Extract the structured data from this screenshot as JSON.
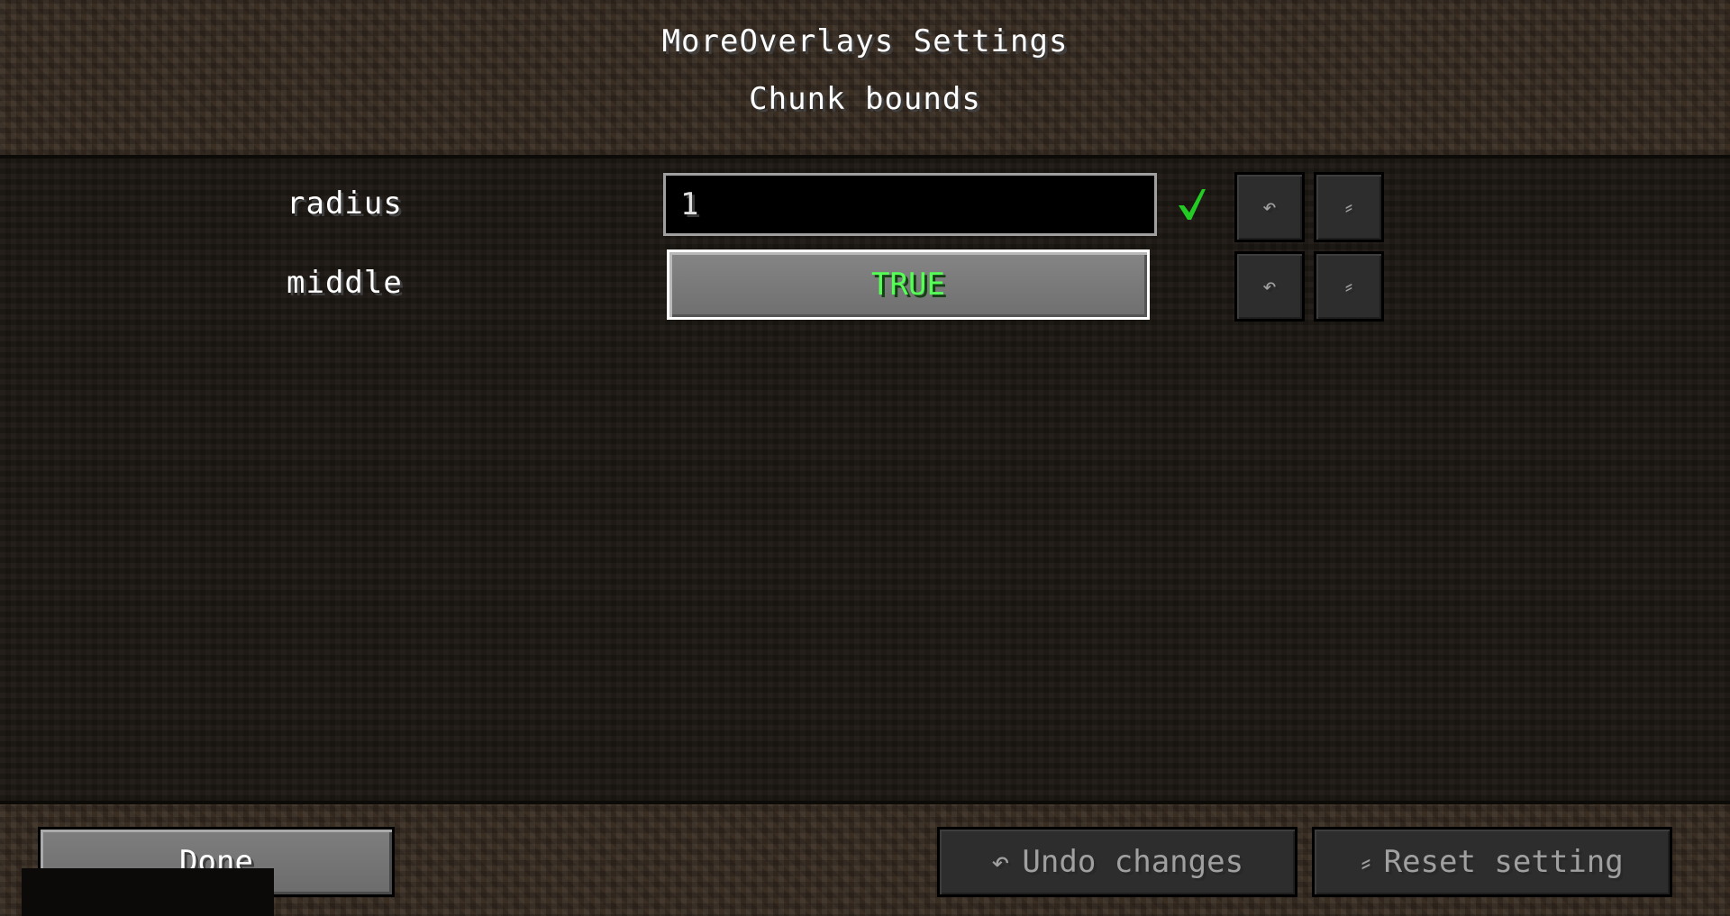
{
  "screen": {
    "title": "MoreOverlays Settings",
    "subtitle": "Chunk bounds"
  },
  "settings": [
    {
      "label": "radius",
      "control": "text",
      "value": "1",
      "valid": true,
      "undo_icon": "↶",
      "reset_icon": "⸗"
    },
    {
      "label": "middle",
      "control": "toggle",
      "value": "TRUE",
      "undo_icon": "↶",
      "reset_icon": "⸗"
    }
  ],
  "footer": {
    "done_label": "Done",
    "undo_label": "Undo changes",
    "reset_label": "Reset setting",
    "undo_icon": "↶",
    "reset_icon": "⸗"
  },
  "colors": {
    "true_value": "#55ff55",
    "valid_check": "#22cc22"
  }
}
